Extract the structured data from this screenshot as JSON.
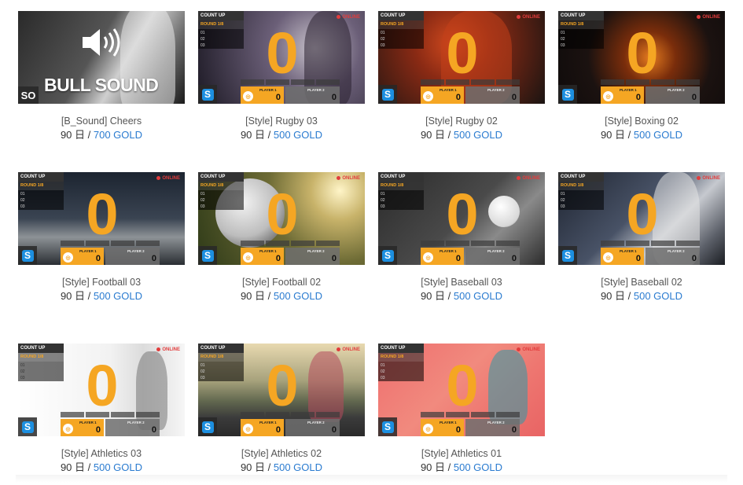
{
  "overlay": {
    "count_up": "COUNT UP",
    "round_label": "ROUND",
    "round_value": "1/8",
    "rows": [
      "01",
      "02",
      "03"
    ],
    "online": "ONLINE",
    "score": "0",
    "player1": "PLAYER 1",
    "player2": "PLAYER 2",
    "s_icon": "S"
  },
  "cheers": {
    "title": "BULL SOUND",
    "badge": "SO"
  },
  "items": [
    {
      "caption": "[B_Sound] Cheers",
      "days": "90 日",
      "sep": " / ",
      "gold": "700 GOLD"
    },
    {
      "caption": "[Style] Rugby 03",
      "days": "90 日",
      "sep": " / ",
      "gold": "500 GOLD"
    },
    {
      "caption": "[Style] Rugby 02",
      "days": "90 日",
      "sep": " / ",
      "gold": "500 GOLD"
    },
    {
      "caption": "[Style] Boxing 02",
      "days": "90 日",
      "sep": " / ",
      "gold": "500 GOLD"
    },
    {
      "caption": "[Style] Football 03",
      "days": "90 日",
      "sep": " / ",
      "gold": "500 GOLD"
    },
    {
      "caption": "[Style] Football 02",
      "days": "90 日",
      "sep": " / ",
      "gold": "500 GOLD"
    },
    {
      "caption": "[Style] Baseball 03",
      "days": "90 日",
      "sep": " / ",
      "gold": "500 GOLD"
    },
    {
      "caption": "[Style] Baseball 02",
      "days": "90 日",
      "sep": " / ",
      "gold": "500 GOLD"
    },
    {
      "caption": "[Style] Athletics 03",
      "days": "90 日",
      "sep": " / ",
      "gold": "500 GOLD"
    },
    {
      "caption": "[Style] Athletics 02",
      "days": "90 日",
      "sep": " / ",
      "gold": "500 GOLD"
    },
    {
      "caption": "[Style] Athletics 01",
      "days": "90 日",
      "sep": " / ",
      "gold": "500 GOLD"
    }
  ],
  "colors": {
    "accent_orange": "#f5a623",
    "link_blue": "#2a7bd0",
    "online_red": "#e23c3c",
    "s_blue": "#1c8fe0"
  }
}
